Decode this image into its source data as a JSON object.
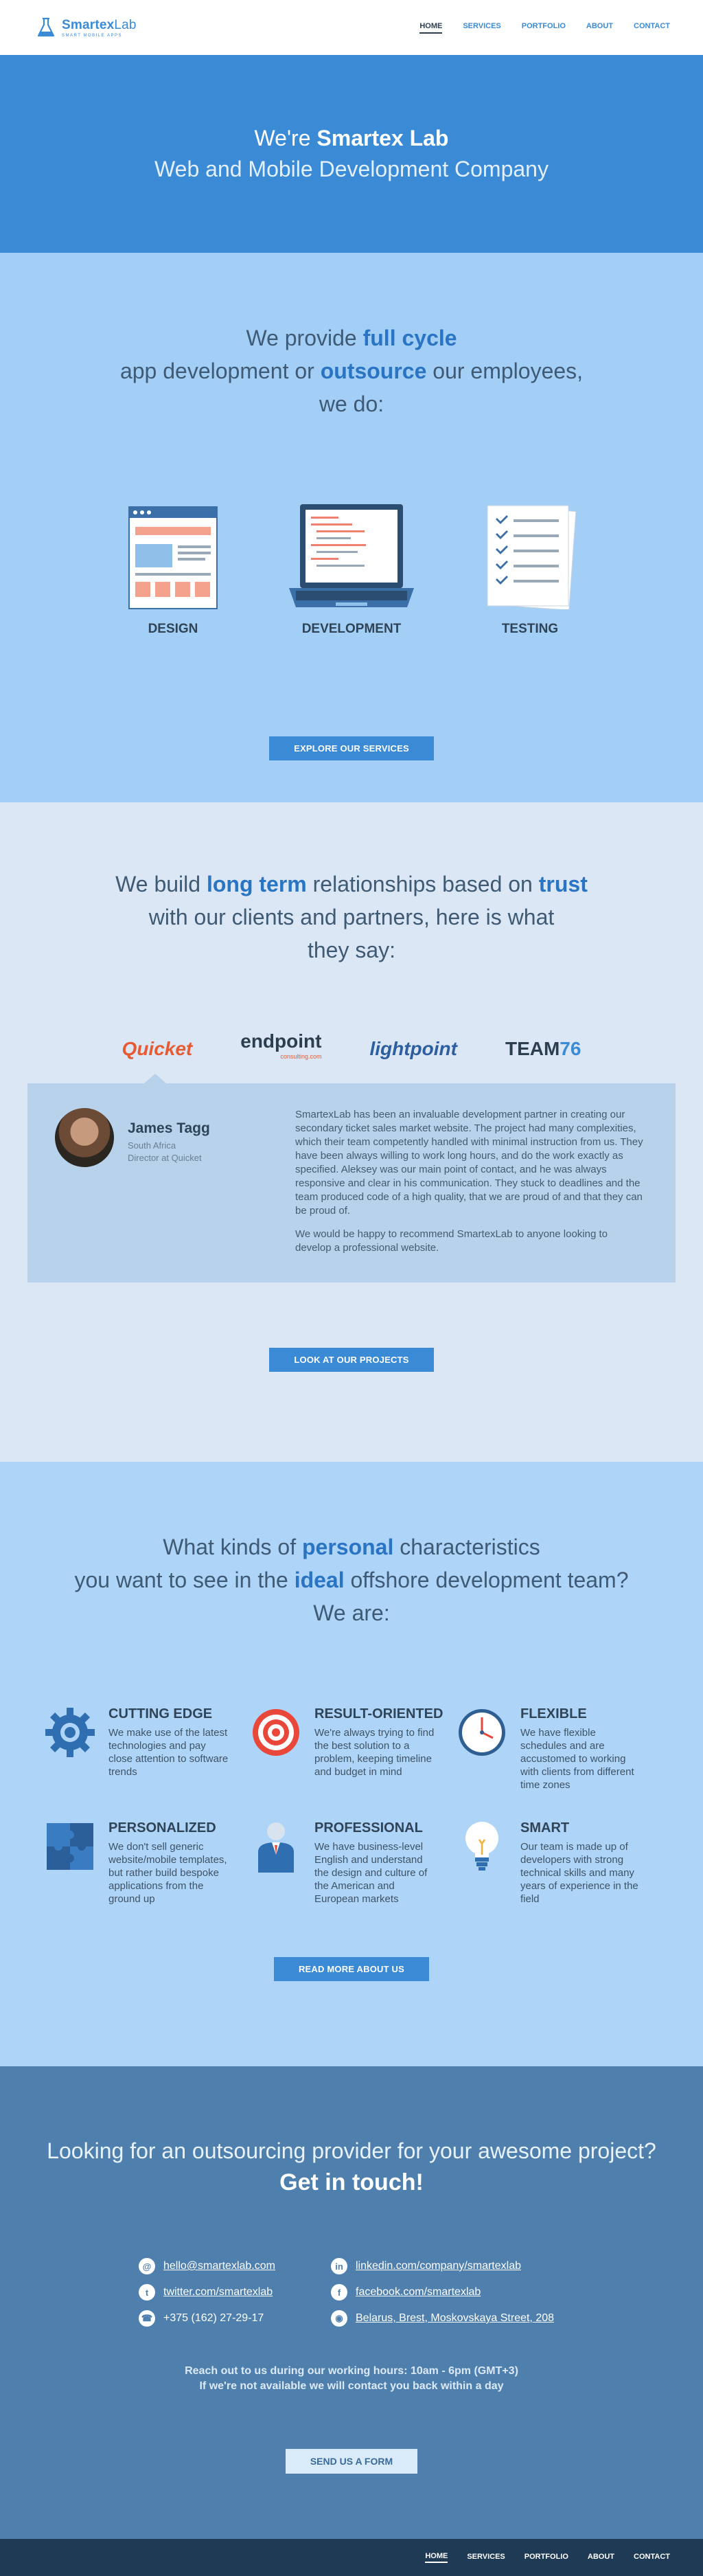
{
  "header": {
    "logo_name_a": "Smartex",
    "logo_name_b": "Lab",
    "logo_tag": "SMART MOBILE APPS",
    "nav": [
      "HOME",
      "SERVICES",
      "PORTFOLIO",
      "ABOUT",
      "CONTACT"
    ],
    "active": "HOME"
  },
  "hero": {
    "line1_pre": "We're ",
    "line1_strong": "Smartex Lab",
    "line2": "Web and Mobile Development Company"
  },
  "services": {
    "lead_a": "We provide ",
    "lead_b": "full cycle",
    "lead_c": "app development or ",
    "lead_d": "outsource",
    "lead_e": " our employees,",
    "lead_f": "we do:",
    "items": [
      "DESIGN",
      "DEVELOPMENT",
      "TESTING"
    ],
    "button": "EXPLORE OUR SERVICES"
  },
  "clients": {
    "lead_a": "We build ",
    "lead_b": "long term",
    "lead_c": " relationships based on ",
    "lead_d": "trust",
    "lead_e": "with our clients and partners, here is what",
    "lead_f": "they say:",
    "logos": [
      "Quicket",
      "endpoint",
      "lightpoint",
      "TEAM",
      "76"
    ],
    "endpoint_sub": "consulting.com",
    "testimonial": {
      "name": "James Tagg",
      "country": "South Africa",
      "role": "Director at Quicket",
      "p1": "SmartexLab has been an invaluable development partner in creating our secondary ticket sales market website. The project had many complexities, which their team competently handled with minimal instruction from us. They have been always willing to work long hours, and do the work exactly as specified. Aleksey was our main point of contact, and he was always responsive and clear in his communication. They stuck to deadlines and the team produced code of a high quality, that we are proud of and that they can be proud of.",
      "p2": "We would be happy to recommend SmartexLab to anyone looking to develop a professional website."
    },
    "button": "LOOK AT OUR PROJECTS"
  },
  "traits": {
    "lead_a": "What kinds of ",
    "lead_b": "personal",
    "lead_c": " characteristics",
    "lead_d": "you want to see in the ",
    "lead_e": "ideal",
    "lead_f": " offshore development team?",
    "lead_g": "We are:",
    "items": [
      {
        "title": "CUTTING EDGE",
        "text": "We make use of the latest technologies and pay close attention to software trends",
        "icon": "gear-icon"
      },
      {
        "title": "RESULT-ORIENTED",
        "text": "We're always trying to find the best solution to a problem, keeping timeline and budget in mind",
        "icon": "target-icon"
      },
      {
        "title": "FLEXIBLE",
        "text": "We have flexible schedules and are accustomed to working with clients from different time zones",
        "icon": "clock-icon"
      },
      {
        "title": "PERSONALIZED",
        "text": "We don't sell generic website/mobile templates, but rather build bespoke applications from the ground up",
        "icon": "puzzle-icon"
      },
      {
        "title": "PROFESSIONAL",
        "text": "We have business-level English and understand the design and culture of the American and European markets",
        "icon": "person-icon"
      },
      {
        "title": "SMART",
        "text": "Our team is made up of developers with strong technical skills and many years of experience in the field",
        "icon": "bulb-icon"
      }
    ],
    "button": "READ MORE ABOUT US"
  },
  "contact": {
    "h1": "Looking for an outsourcing provider for your awesome project?",
    "h2": "Get in touch!",
    "links": [
      {
        "icon": "mail-icon",
        "glyph": "@",
        "text": "hello@smartexlab.com"
      },
      {
        "icon": "linkedin-icon",
        "glyph": "in",
        "text": "linkedin.com/company/smartexlab"
      },
      {
        "icon": "twitter-icon",
        "glyph": "t",
        "text": "twitter.com/smartexlab"
      },
      {
        "icon": "facebook-icon",
        "glyph": "f",
        "text": "facebook.com/smartexlab"
      },
      {
        "icon": "phone-icon",
        "glyph": "☎",
        "text": "+375 (162) 27-29-17"
      },
      {
        "icon": "pin-icon",
        "glyph": "◉",
        "text": "Belarus, Brest, Moskovskaya Street, 208"
      }
    ],
    "hours1": "Reach out to us during our working hours: 10am - 6pm (GMT+3)",
    "hours2": "If we're not available we will contact you back within a day",
    "button": "SEND US A FORM"
  },
  "footer": {
    "nav": [
      "HOME",
      "SERVICES",
      "PORTFOLIO",
      "ABOUT",
      "CONTACT"
    ],
    "active": "HOME"
  },
  "colors": {
    "brand": "#3a8ad6",
    "hero_bg": "#3a8ad6",
    "services_bg": "#a3cef5",
    "clients_bg": "#dbe7f4",
    "traits_bg": "#aed4f8",
    "contact_bg": "#4f80ad",
    "footer_bg": "#1e3a55"
  }
}
